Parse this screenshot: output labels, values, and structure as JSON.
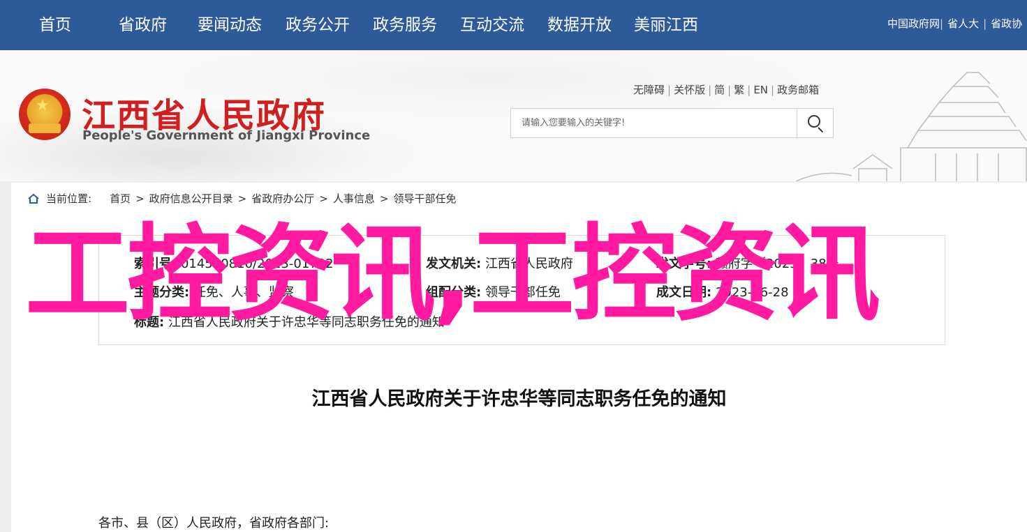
{
  "nav": {
    "items": [
      "首页",
      "省政府",
      "要闻动态",
      "政务公开",
      "政务服务",
      "互动交流",
      "数据开放",
      "美丽江西"
    ],
    "right_links": [
      "中国政府网",
      "省人大",
      "省政协"
    ]
  },
  "header": {
    "title": "江西省人民政府",
    "subtitle": "People's Government of Jiangxi Province",
    "util_links": [
      "无障碍",
      "关怀版",
      "简",
      "繁",
      "EN",
      "政务邮箱"
    ],
    "search_placeholder": "请输入您要输入的关键字!"
  },
  "breadcrumb": {
    "label": "当前位置:",
    "items": [
      "首页",
      "政府信息公开目录",
      "省政府办公厅",
      "人事信息",
      "领导干部任免"
    ]
  },
  "meta": {
    "index_label": "索引号:",
    "index_value": "014500810/2023-01732",
    "issuer_label": "发文机关:",
    "issuer_value": "江西省人民政府",
    "docno_label": "发文字号:",
    "docno_value": "赣府字〔2023〕38号",
    "topic_label": "主题分类:",
    "topic_value": "任免、人事、监察",
    "category_label": "组配分类:",
    "category_value": "领导干部任免",
    "date_label": "成文日期:",
    "date_value": "2023-06-28",
    "title_label": "标题:",
    "title_value": "江西省人民政府关于许忠华等同志职务任免的通知"
  },
  "watermark": "工控资讯,工控资讯",
  "document": {
    "title": "江西省人民政府关于许忠华等同志职务任免的通知",
    "salutation": "各市、县（区）人民政府，省政府各部门:"
  }
}
